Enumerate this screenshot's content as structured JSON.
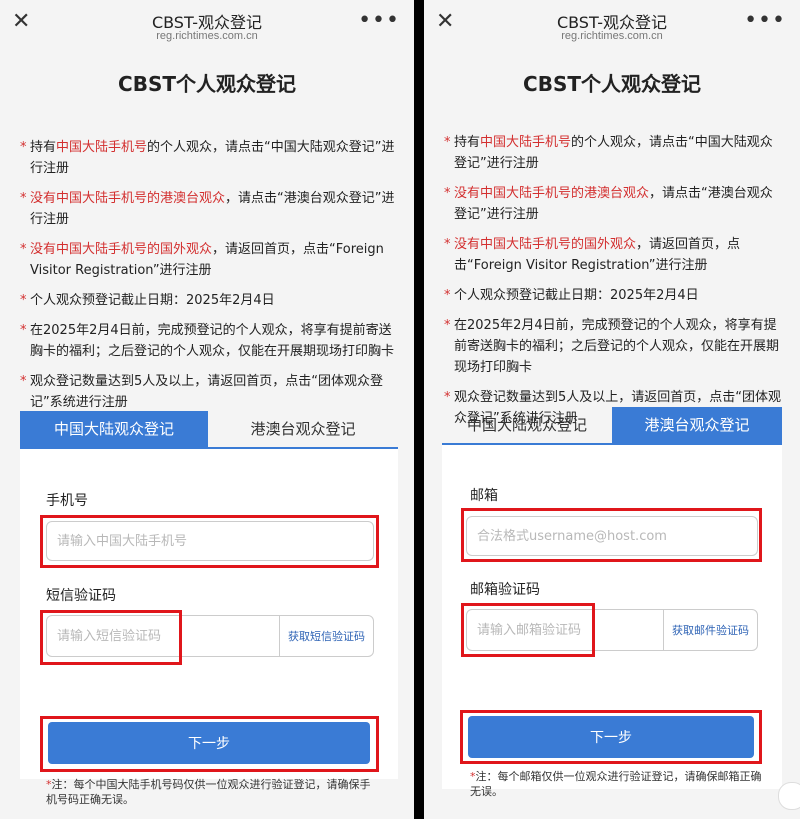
{
  "header": {
    "title": "CBST-观众登记",
    "url": "reg.richtimes.com.cn",
    "close_icon": "close-icon",
    "more_icon": "more-icon"
  },
  "page_title": "CBST个人观众登记",
  "notes_left": [
    {
      "red": "中国大陆手机号",
      "pre": "持有",
      "post": "的个人观众，请点击“中国大陆观众登记”进行注册"
    },
    {
      "red": "没有中国大陆手机号的港澳台观众",
      "pre": "",
      "post": "，请点击“港澳台观众登记”进行注册"
    },
    {
      "red": "没有中国大陆手机号的国外观众",
      "pre": "",
      "post": "，请返回首页，点击“Foreign Visitor Registration”进行注册"
    },
    {
      "red": "",
      "pre": "个人观众预登记截止日期：2025年2月4日",
      "post": ""
    },
    {
      "red": "",
      "pre": "在2025年2月4日前，完成预登记的个人观众，将享有提前寄送胸卡的福利；之后登记的个人观众，仅能在开展期现场打印胸卡",
      "post": ""
    },
    {
      "red": "",
      "pre": "观众登记数量达到5人及以上，请返回首页，点击“团体观众登记”系统进行注册",
      "post": ""
    }
  ],
  "notes_right": [
    {
      "red": "中国大陆手机号",
      "pre": "持有",
      "post": "的个人观众，请点击“中国大陆观众登记”进行注册"
    },
    {
      "red": "没有中国大陆手机号的港澳台观众",
      "pre": "",
      "post": "，请点击“港澳台观众登记”进行注册"
    },
    {
      "red": "没有中国大陆手机号的国外观众",
      "pre": "",
      "post": "，请返回首页，点击“Foreign Visitor Registration”进行注册"
    },
    {
      "red": "",
      "pre": "个人观众预登记截止日期：2025年2月4日",
      "post": ""
    },
    {
      "red": "",
      "pre": "在2025年2月4日前，完成预登记的个人观众，将享有提前寄送胸卡的福利；之后登记的个人观众，仅能在开展期现场打印胸卡",
      "post": ""
    },
    {
      "red": "",
      "pre": "观众登记数量达到5人及以上，请返回首页，点击“团体观众登记”系统进行注册",
      "post": ""
    }
  ],
  "tabs": {
    "mainland": "中国大陆观众登记",
    "hkmt": "港澳台观众登记"
  },
  "left_form": {
    "phone_label": "手机号",
    "phone_placeholder": "请输入中国大陆手机号",
    "sms_label": "短信验证码",
    "sms_placeholder": "请输入短信验证码",
    "sms_button": "获取短信验证码",
    "next": "下一步",
    "footnote_star": "*",
    "footnote": "注：每个中国大陆手机号码仅供一位观众进行验证登记，请确保手机号码正确无误。"
  },
  "right_form": {
    "email_label": "邮箱",
    "email_placeholder": "合法格式username@host.com",
    "code_label": "邮箱验证码",
    "code_placeholder": "请输入邮箱验证码",
    "code_button": "获取邮件验证码",
    "next": "下一步",
    "footnote_star": "*",
    "footnote": "注：每个邮箱仅供一位观众进行验证登记，请确保邮箱正确无误。"
  },
  "colors": {
    "accent": "#3a7bd5",
    "highlight": "#e0161b",
    "red_text": "#d32f2f"
  }
}
